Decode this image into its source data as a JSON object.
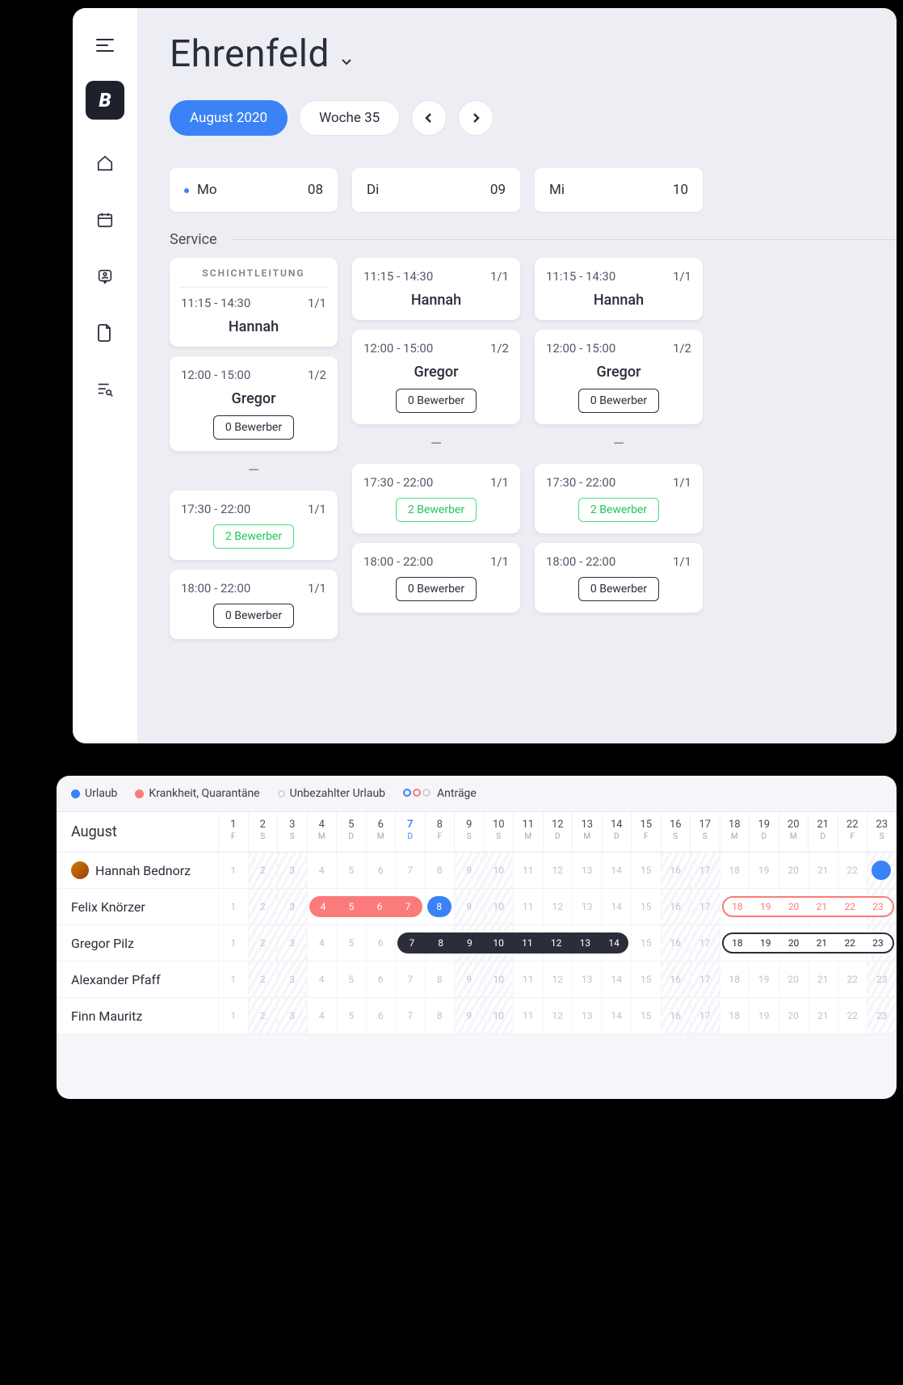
{
  "top": {
    "logo": "B",
    "title": "Ehrenfeld",
    "month_pill": "August 2020",
    "week_pill": "Woche 35",
    "days": [
      {
        "abbr": "Mo",
        "num": "08",
        "today": true
      },
      {
        "abbr": "Di",
        "num": "09",
        "today": false
      },
      {
        "abbr": "Mi",
        "num": "10",
        "today": false
      }
    ],
    "section": "Service",
    "subhead": "SCHICHTLEITUNG",
    "applicants_0": "0 Bewerber",
    "applicants_2": "2 Bewerber",
    "columns": [
      [
        {
          "time": "11:15 - 14:30",
          "count": "1/1",
          "name": "Hannah",
          "subhead": true
        },
        {
          "time": "12:00 - 15:00",
          "count": "1/2",
          "name": "Gregor",
          "chip": "applicants_0"
        },
        {
          "divider": "—"
        },
        {
          "time": "17:30 - 22:00",
          "count": "1/1",
          "chip": "applicants_2",
          "chip_green": true
        },
        {
          "time": "18:00 - 22:00",
          "count": "1/1",
          "chip": "applicants_0"
        }
      ],
      [
        {
          "time": "11:15 - 14:30",
          "count": "1/1",
          "name": "Hannah"
        },
        {
          "time": "12:00 - 15:00",
          "count": "1/2",
          "name": "Gregor",
          "chip": "applicants_0"
        },
        {
          "divider": "—"
        },
        {
          "time": "17:30 - 22:00",
          "count": "1/1",
          "chip": "applicants_2",
          "chip_green": true
        },
        {
          "time": "18:00 - 22:00",
          "count": "1/1",
          "chip": "applicants_0"
        }
      ],
      [
        {
          "time": "11:15 - 14:30",
          "count": "1/1",
          "name": "Hannah"
        },
        {
          "time": "12:00 - 15:00",
          "count": "1/2",
          "name": "Gregor",
          "chip": "applicants_0"
        },
        {
          "divider": "—"
        },
        {
          "time": "17:30 - 22:00",
          "count": "1/1",
          "chip": "applicants_2",
          "chip_green": true
        },
        {
          "time": "18:00 - 22:00",
          "count": "1/1",
          "chip": "applicants_0"
        }
      ]
    ]
  },
  "bottom": {
    "legend": {
      "urlaub": "Urlaub",
      "krank": "Krankheit, Quarantäne",
      "unbez": "Unbezahlter Urlaub",
      "antrage": "Anträge"
    },
    "month": "August",
    "day_headers": [
      {
        "n": "1",
        "w": "F"
      },
      {
        "n": "2",
        "w": "S"
      },
      {
        "n": "3",
        "w": "S"
      },
      {
        "n": "4",
        "w": "M"
      },
      {
        "n": "5",
        "w": "D"
      },
      {
        "n": "6",
        "w": "M"
      },
      {
        "n": "7",
        "w": "D",
        "today": true
      },
      {
        "n": "8",
        "w": "F"
      },
      {
        "n": "9",
        "w": "S"
      },
      {
        "n": "10",
        "w": "S"
      },
      {
        "n": "11",
        "w": "M"
      },
      {
        "n": "12",
        "w": "D"
      },
      {
        "n": "13",
        "w": "M"
      },
      {
        "n": "14",
        "w": "D"
      },
      {
        "n": "15",
        "w": "F"
      },
      {
        "n": "16",
        "w": "S"
      },
      {
        "n": "17",
        "w": "S"
      },
      {
        "n": "18",
        "w": "M"
      },
      {
        "n": "19",
        "w": "D"
      },
      {
        "n": "20",
        "w": "M"
      },
      {
        "n": "21",
        "w": "D"
      },
      {
        "n": "22",
        "w": "F"
      },
      {
        "n": "23",
        "w": "S"
      }
    ],
    "weekend_days": [
      2,
      3,
      9,
      10,
      16,
      17,
      23
    ],
    "rows": [
      {
        "name": "Hannah Bednorz",
        "avatar": true,
        "today_pill_at": 23
      },
      {
        "name": "Felix Knörzer",
        "bars": [
          {
            "type": "red",
            "from": 4,
            "to": 7
          },
          {
            "type": "blue",
            "from": 8,
            "to": 8
          },
          {
            "type": "outline-red",
            "from": 18,
            "to": 23
          }
        ]
      },
      {
        "name": "Gregor Pilz",
        "bars": [
          {
            "type": "dark",
            "from": 7,
            "to": 14
          },
          {
            "type": "outline-dark",
            "from": 18,
            "to": 23
          }
        ]
      },
      {
        "name": "Alexander Pfaff"
      },
      {
        "name": "Finn Mauritz"
      }
    ]
  }
}
